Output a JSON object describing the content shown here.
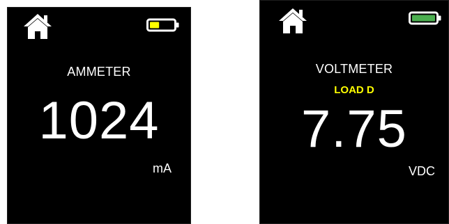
{
  "colors": {
    "screen_background": "#000000",
    "text": "#ffffff",
    "load_label": "#ffff00",
    "battery_low_fill": "#ffff00",
    "battery_full_fill": "#4caf50"
  },
  "screens": [
    {
      "icons": [
        "home-icon",
        "battery-low-icon"
      ],
      "battery_level": 0.4,
      "title": "AMMETER",
      "reading": "1024",
      "unit": "mA"
    },
    {
      "icons": [
        "home-icon",
        "battery-full-icon"
      ],
      "battery_level": 1.0,
      "title": "VOLTMETER",
      "load": "LOAD D",
      "reading": "7.75",
      "unit": "VDC"
    }
  ]
}
